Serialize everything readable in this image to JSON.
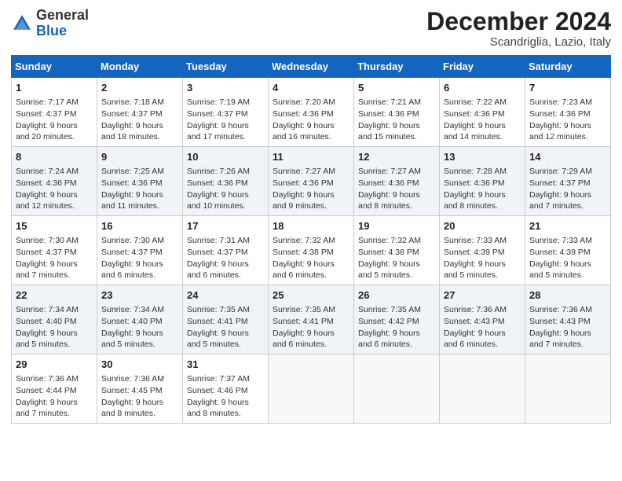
{
  "header": {
    "logo": {
      "general": "General",
      "blue": "Blue"
    },
    "month": "December 2024",
    "location": "Scandriglia, Lazio, Italy"
  },
  "weekdays": [
    "Sunday",
    "Monday",
    "Tuesday",
    "Wednesday",
    "Thursday",
    "Friday",
    "Saturday"
  ],
  "weeks": [
    [
      {
        "day": "1",
        "sunrise": "Sunrise: 7:17 AM",
        "sunset": "Sunset: 4:37 PM",
        "daylight": "Daylight: 9 hours and 20 minutes."
      },
      {
        "day": "2",
        "sunrise": "Sunrise: 7:18 AM",
        "sunset": "Sunset: 4:37 PM",
        "daylight": "Daylight: 9 hours and 18 minutes."
      },
      {
        "day": "3",
        "sunrise": "Sunrise: 7:19 AM",
        "sunset": "Sunset: 4:37 PM",
        "daylight": "Daylight: 9 hours and 17 minutes."
      },
      {
        "day": "4",
        "sunrise": "Sunrise: 7:20 AM",
        "sunset": "Sunset: 4:36 PM",
        "daylight": "Daylight: 9 hours and 16 minutes."
      },
      {
        "day": "5",
        "sunrise": "Sunrise: 7:21 AM",
        "sunset": "Sunset: 4:36 PM",
        "daylight": "Daylight: 9 hours and 15 minutes."
      },
      {
        "day": "6",
        "sunrise": "Sunrise: 7:22 AM",
        "sunset": "Sunset: 4:36 PM",
        "daylight": "Daylight: 9 hours and 14 minutes."
      },
      {
        "day": "7",
        "sunrise": "Sunrise: 7:23 AM",
        "sunset": "Sunset: 4:36 PM",
        "daylight": "Daylight: 9 hours and 12 minutes."
      }
    ],
    [
      {
        "day": "8",
        "sunrise": "Sunrise: 7:24 AM",
        "sunset": "Sunset: 4:36 PM",
        "daylight": "Daylight: 9 hours and 12 minutes."
      },
      {
        "day": "9",
        "sunrise": "Sunrise: 7:25 AM",
        "sunset": "Sunset: 4:36 PM",
        "daylight": "Daylight: 9 hours and 11 minutes."
      },
      {
        "day": "10",
        "sunrise": "Sunrise: 7:26 AM",
        "sunset": "Sunset: 4:36 PM",
        "daylight": "Daylight: 9 hours and 10 minutes."
      },
      {
        "day": "11",
        "sunrise": "Sunrise: 7:27 AM",
        "sunset": "Sunset: 4:36 PM",
        "daylight": "Daylight: 9 hours and 9 minutes."
      },
      {
        "day": "12",
        "sunrise": "Sunrise: 7:27 AM",
        "sunset": "Sunset: 4:36 PM",
        "daylight": "Daylight: 9 hours and 8 minutes."
      },
      {
        "day": "13",
        "sunrise": "Sunrise: 7:28 AM",
        "sunset": "Sunset: 4:36 PM",
        "daylight": "Daylight: 9 hours and 8 minutes."
      },
      {
        "day": "14",
        "sunrise": "Sunrise: 7:29 AM",
        "sunset": "Sunset: 4:37 PM",
        "daylight": "Daylight: 9 hours and 7 minutes."
      }
    ],
    [
      {
        "day": "15",
        "sunrise": "Sunrise: 7:30 AM",
        "sunset": "Sunset: 4:37 PM",
        "daylight": "Daylight: 9 hours and 7 minutes."
      },
      {
        "day": "16",
        "sunrise": "Sunrise: 7:30 AM",
        "sunset": "Sunset: 4:37 PM",
        "daylight": "Daylight: 9 hours and 6 minutes."
      },
      {
        "day": "17",
        "sunrise": "Sunrise: 7:31 AM",
        "sunset": "Sunset: 4:37 PM",
        "daylight": "Daylight: 9 hours and 6 minutes."
      },
      {
        "day": "18",
        "sunrise": "Sunrise: 7:32 AM",
        "sunset": "Sunset: 4:38 PM",
        "daylight": "Daylight: 9 hours and 6 minutes."
      },
      {
        "day": "19",
        "sunrise": "Sunrise: 7:32 AM",
        "sunset": "Sunset: 4:38 PM",
        "daylight": "Daylight: 9 hours and 5 minutes."
      },
      {
        "day": "20",
        "sunrise": "Sunrise: 7:33 AM",
        "sunset": "Sunset: 4:39 PM",
        "daylight": "Daylight: 9 hours and 5 minutes."
      },
      {
        "day": "21",
        "sunrise": "Sunrise: 7:33 AM",
        "sunset": "Sunset: 4:39 PM",
        "daylight": "Daylight: 9 hours and 5 minutes."
      }
    ],
    [
      {
        "day": "22",
        "sunrise": "Sunrise: 7:34 AM",
        "sunset": "Sunset: 4:40 PM",
        "daylight": "Daylight: 9 hours and 5 minutes."
      },
      {
        "day": "23",
        "sunrise": "Sunrise: 7:34 AM",
        "sunset": "Sunset: 4:40 PM",
        "daylight": "Daylight: 9 hours and 5 minutes."
      },
      {
        "day": "24",
        "sunrise": "Sunrise: 7:35 AM",
        "sunset": "Sunset: 4:41 PM",
        "daylight": "Daylight: 9 hours and 5 minutes."
      },
      {
        "day": "25",
        "sunrise": "Sunrise: 7:35 AM",
        "sunset": "Sunset: 4:41 PM",
        "daylight": "Daylight: 9 hours and 6 minutes."
      },
      {
        "day": "26",
        "sunrise": "Sunrise: 7:35 AM",
        "sunset": "Sunset: 4:42 PM",
        "daylight": "Daylight: 9 hours and 6 minutes."
      },
      {
        "day": "27",
        "sunrise": "Sunrise: 7:36 AM",
        "sunset": "Sunset: 4:43 PM",
        "daylight": "Daylight: 9 hours and 6 minutes."
      },
      {
        "day": "28",
        "sunrise": "Sunrise: 7:36 AM",
        "sunset": "Sunset: 4:43 PM",
        "daylight": "Daylight: 9 hours and 7 minutes."
      }
    ],
    [
      {
        "day": "29",
        "sunrise": "Sunrise: 7:36 AM",
        "sunset": "Sunset: 4:44 PM",
        "daylight": "Daylight: 9 hours and 7 minutes."
      },
      {
        "day": "30",
        "sunrise": "Sunrise: 7:36 AM",
        "sunset": "Sunset: 4:45 PM",
        "daylight": "Daylight: 9 hours and 8 minutes."
      },
      {
        "day": "31",
        "sunrise": "Sunrise: 7:37 AM",
        "sunset": "Sunset: 4:46 PM",
        "daylight": "Daylight: 9 hours and 8 minutes."
      },
      null,
      null,
      null,
      null
    ]
  ]
}
